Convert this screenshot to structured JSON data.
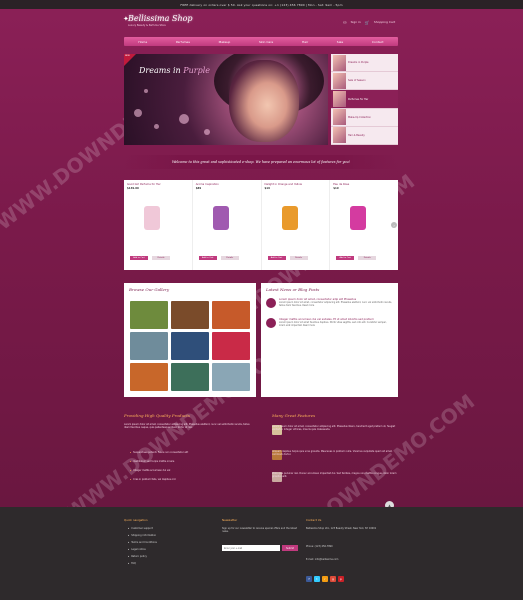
{
  "topbar": {
    "text": "FREE delivery on orders over $ 50. Ask your questions on: +1 (123) 456 7890 | Mon - Sat: 9am - 5pm"
  },
  "brand": {
    "name": "Bellissima Shop",
    "tagline": "Luxury Beauty & Perfume Store",
    "colors": {
      "magenta": "#8b2057",
      "pink": "#e35d9f",
      "gold": "#ffb35a",
      "footer": "#2e2a2c"
    }
  },
  "account": {
    "login": "Sign in",
    "cart": "Shopping Cart"
  },
  "nav": [
    "Home",
    "Perfumes",
    "Makeup",
    "Skin Care",
    "Hair",
    "Sale",
    "Contact"
  ],
  "slider": {
    "badge": "NEW",
    "title_a": "Dreams in",
    "title_b": "Purple",
    "thumbs": [
      {
        "label": "Dreams in Purple"
      },
      {
        "label": "Sale of Season"
      },
      {
        "label": "Perfumes for Her"
      },
      {
        "label": "Make-Up Collection"
      },
      {
        "label": "Hair & Beauty"
      }
    ]
  },
  "welcome": "Welcome to this great and sophisticated e-shop. We have prepared an enormous lot of features for you!",
  "products": {
    "add_label": "Add to Cart",
    "compare_label": "Details",
    "items": [
      {
        "name": "Good Girl Perfume for Her",
        "price": "$149.00",
        "color": "#f0c8d8"
      },
      {
        "name": "Aroma Inspiration",
        "price": "$89",
        "color": "#a05ab0"
      },
      {
        "name": "Delight in Orange and Yellow",
        "price": "$19",
        "color": "#e99a2c"
      },
      {
        "name": "Eau de Rose",
        "price": "$19",
        "color": "#d43ba0"
      }
    ]
  },
  "gallery": {
    "title": "Browse Our Gallery",
    "tiles": [
      "#6e8b3d",
      "#7a4b2a",
      "#c65a2a",
      "#6f8c9b",
      "#2f4f7a",
      "#c92a47",
      "#c8672a",
      "#3d6f5a",
      "#8aa6b5"
    ]
  },
  "news": {
    "title": "Latest News or Blog Posts",
    "posts": [
      {
        "title": "Lorem ipsum dolor sit amet, consectetur adip elit Phasellus",
        "text": "Lorem ipsum dolor sit amet, consectetur adipiscing elit. Phasellus eleifend, nunc vel sollicitudin iaculis, tellus diam faucibus. Read more"
      },
      {
        "title": "Integer mattis accumsan dui vel sodales. Et ut amet lobortis sed pretium",
        "text": "Lorem ipsum dolor sit amet faucibus dapibus. Morbi vitae sagittis, sed odio elit. Curabitur semper, lorem erat imperdiet. Read more"
      }
    ]
  },
  "quality": {
    "title": "Providing High Quality Products",
    "text": "Lorem ipsum dolor sit amet, consectetur adipiscing elit. Phasellus eleifend, nunc vel sollicitudin iaculis, tellus diam faucibus neque, quis pellentesque libero tortor at nisi.",
    "bullets": [
      "Suspendisse potenti. Fusce non consectetur elit",
      "Vestibulum sed turpis mattis ornare",
      "Integer mattis accumsan dui vel",
      "Cras in pretium felis, vel dapibus orci"
    ]
  },
  "features": {
    "title": "Many Great Features",
    "items": [
      "Lorem ipsum dolor sit amet, consectetur adipiscing elit. Phasellus libero, hendrerit eget pretium ut, feugiat vel tortor. Integer ultrices, mauris quis malesuada.",
      "Aliquam dapibus turpis quis urna gravida. Maecenas in pretium nulla. Vivamus vulputate quam sit amet, commodo tortor.",
      "Proin quis pulvinar nisl. Donec accumsan imperdiet dui. Sed facilisis, magna non mattis congue, dolor lorem gravida velit."
    ]
  },
  "footer": {
    "nav_title": "Quick navigation",
    "links": [
      "Customer support",
      "Shipping information",
      "Terms and Conditions",
      "Legal notice",
      "Return policy",
      "FAQ"
    ],
    "news_title": "Newsletter",
    "news_text": "Sign up for our newsletter to receive special offers and the latest news.",
    "email_placeholder": "Enter your e-mail",
    "subscribe": "Submit",
    "contact_title": "Contact Us",
    "contact_text": "Bellissima Shop Ltd., 123 Beauty Street, New York, NY 10001",
    "phone": "Phone: (123) 456-7890",
    "email": "E-mail: info@bellissima.com",
    "social": [
      {
        "icon": "facebook-icon",
        "color": "#3b5998",
        "glyph": "f"
      },
      {
        "icon": "twitter-icon",
        "color": "#33ccff",
        "glyph": "t"
      },
      {
        "icon": "rss-icon",
        "color": "#f39c12",
        "glyph": "r"
      },
      {
        "icon": "google-icon",
        "color": "#dd4b39",
        "glyph": "g"
      },
      {
        "icon": "pinterest-icon",
        "color": "#cb2027",
        "glyph": "p"
      }
    ]
  },
  "watermark": "WWW.DOWNDEMO.COM"
}
